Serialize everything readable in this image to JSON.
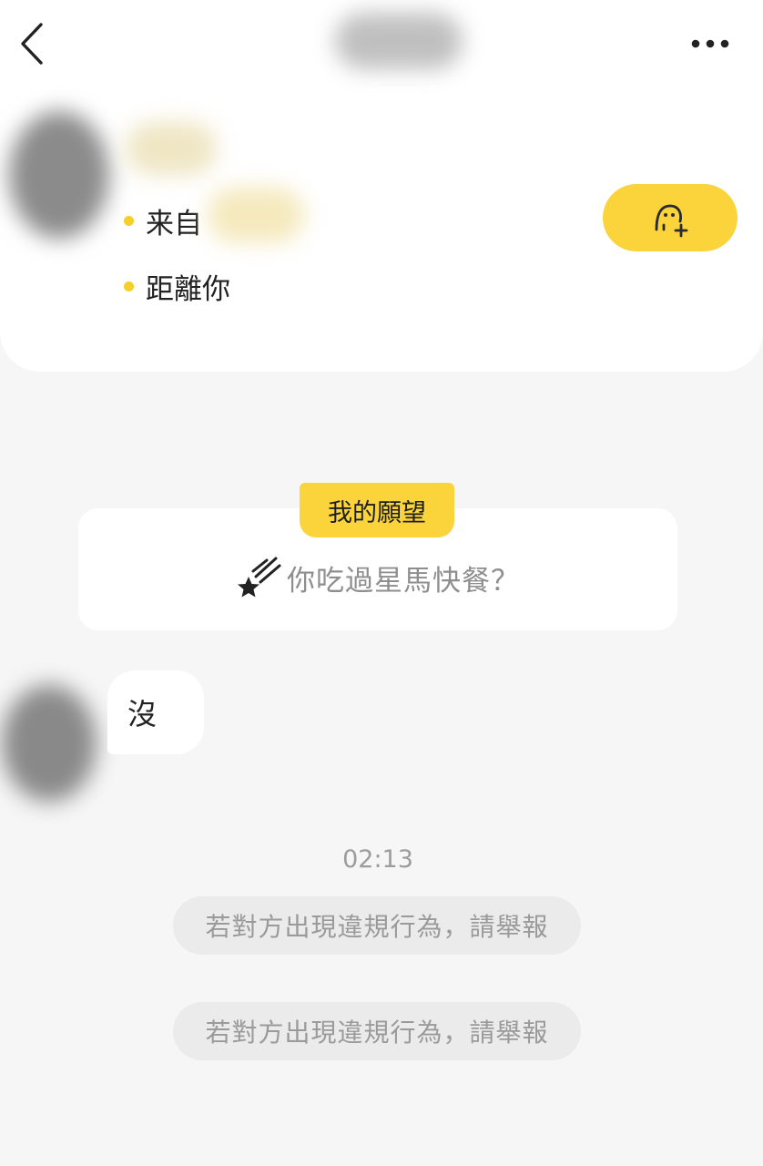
{
  "icons": {
    "back": "chevron-left-icon",
    "more": "more-horizontal-icon",
    "add_friend": "add-user-icon",
    "wish": "shooting-star-icon"
  },
  "colors": {
    "accent": "#fad43a",
    "dot": "#f5cf2a",
    "background": "#f6f6f6",
    "card": "#ffffff",
    "muted_text": "#9a9a9a"
  },
  "profile": {
    "from_label": "来自",
    "distance_label": "距離你"
  },
  "wish": {
    "label": "我的願望",
    "question": "你吃過星馬快餐？"
  },
  "chat": {
    "message": "沒",
    "timestamp": "02:13",
    "system_notices": [
      "若對方出現違規行為，請舉報",
      "若對方出現違規行為，請舉報"
    ]
  }
}
